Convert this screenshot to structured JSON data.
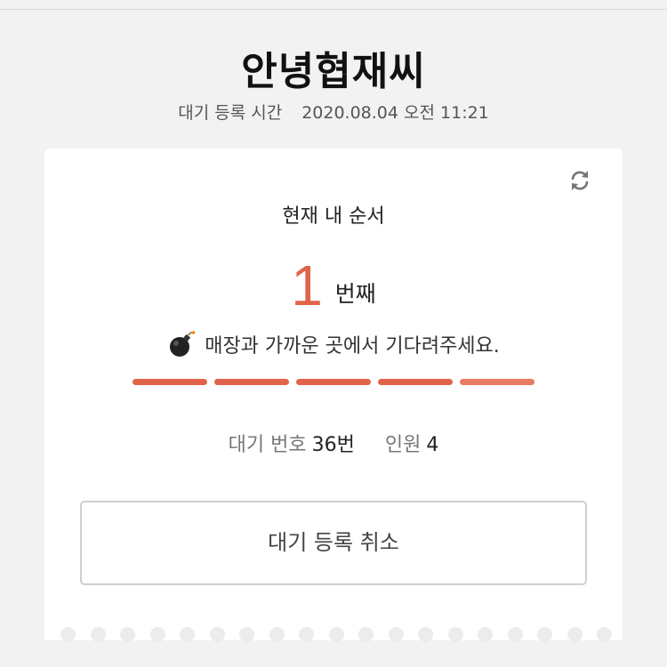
{
  "header": {
    "title": "안녕협재씨",
    "registered_label": "대기 등록 시간",
    "registered_time": "2020.08.04 오전 11:21"
  },
  "card": {
    "refresh_icon": "refresh-icon",
    "order_label": "현재 내 순서",
    "order_number": "1",
    "order_unit": "번째",
    "message_icon": "bomb-icon",
    "message": "매장과 가까운 곳에서 기다려주세요.",
    "progress_segments": 5,
    "waiting_number_label": "대기 번호",
    "waiting_number_value": "36번",
    "party_label": "인원",
    "party_value": "4",
    "cancel_label": "대기 등록 취소"
  },
  "colors": {
    "accent": "#e0644a",
    "background": "#f2f2f2",
    "card": "#ffffff"
  }
}
